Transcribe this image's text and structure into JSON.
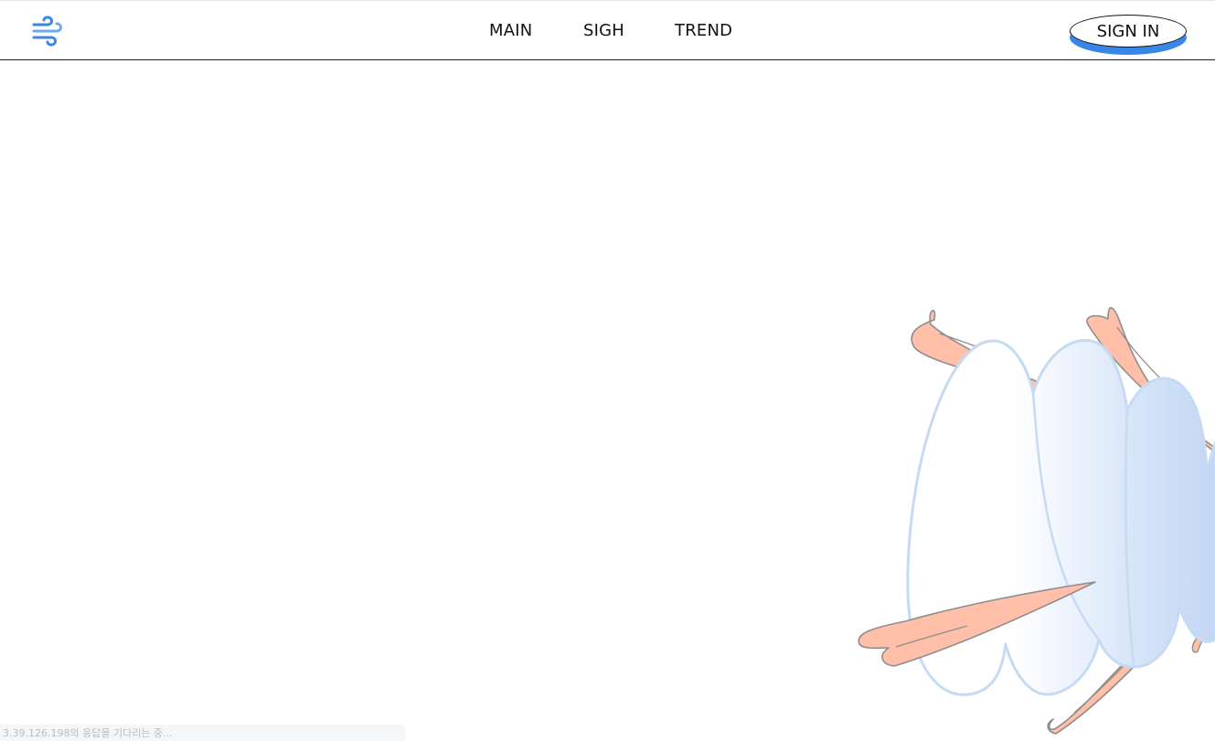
{
  "header": {
    "logo_icon": "wind-icon",
    "logo_color": "#3a86e8",
    "nav": [
      {
        "label": "MAIN"
      },
      {
        "label": "SIGH"
      },
      {
        "label": "TREND"
      }
    ],
    "signin_label": "SIGN IN",
    "signin_accent": "#3a86e8"
  },
  "illustration": {
    "icon": "winged-cloud-illustration",
    "wing_color": "#ffbfa8",
    "cloud_color_light": "#ffffff",
    "cloud_color_dark": "#c8daf6",
    "cloud_stroke": "#c5daf4"
  },
  "status_bar": {
    "text": "3.39.126.198의 응답을 기다리는 중..."
  }
}
